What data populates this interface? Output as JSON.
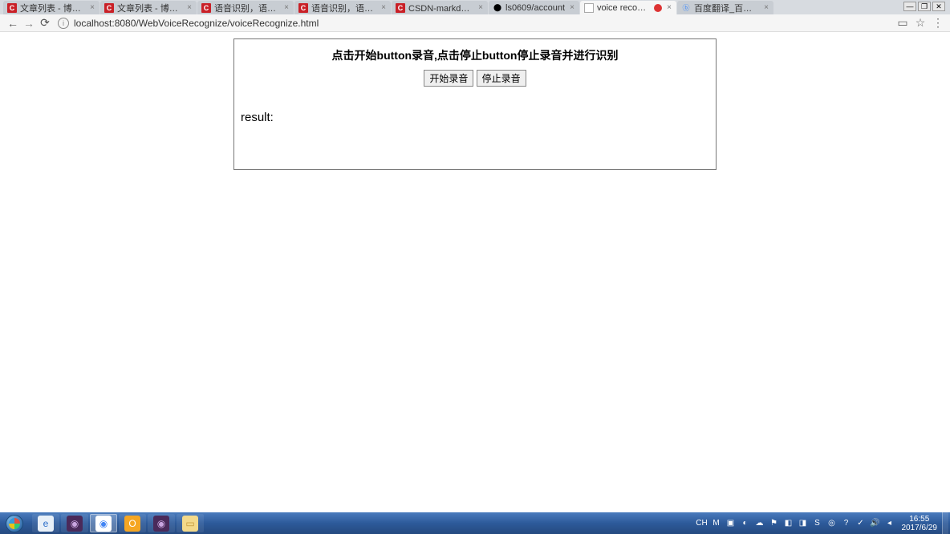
{
  "window_controls": {
    "minimize": "—",
    "restore": "❐",
    "close": "✕"
  },
  "tabs": [
    {
      "title": "文章列表 - 博客频道 - C",
      "favicon": "csdn",
      "faviconText": "C",
      "active": false
    },
    {
      "title": "文章列表 - 博客频道 - C",
      "favicon": "csdn",
      "faviconText": "C",
      "active": false
    },
    {
      "title": "语音识别，语义理解一站",
      "favicon": "csdn",
      "faviconText": "C",
      "active": false
    },
    {
      "title": "语音识别，语义理解一站",
      "favicon": "csdn",
      "faviconText": "C",
      "active": false
    },
    {
      "title": "CSDN-markdown编辑",
      "favicon": "csdn",
      "faviconText": "C",
      "active": false
    },
    {
      "title": "ls0609/account",
      "favicon": "github",
      "faviconText": "⬤",
      "active": false
    },
    {
      "title": "voice recognize test",
      "favicon": "blank",
      "faviconText": "",
      "active": true,
      "recording": true
    },
    {
      "title": "百度翻译_百度搜索",
      "favicon": "baidu",
      "faviconText": "ⓑ",
      "active": false
    }
  ],
  "url": "localhost:8080/WebVoiceRecognize/voiceRecognize.html",
  "page": {
    "heading": "点击开始button录音,点击停止button停止录音并进行识别",
    "startBtn": "开始录音",
    "stopBtn": "停止录音",
    "resultLabel": "result:"
  },
  "taskbar": {
    "items": [
      {
        "name": "ie",
        "bg": "#e8f0f8",
        "text": "e",
        "color": "#2a6dc9"
      },
      {
        "name": "eclipse1",
        "bg": "#4a2a5a",
        "text": "◉",
        "color": "#c9a6e0"
      },
      {
        "name": "chrome",
        "bg": "#fff",
        "text": "◉",
        "color": "#4285f4",
        "active": true
      },
      {
        "name": "outlook",
        "bg": "#f5a623",
        "text": "O",
        "color": "#fff"
      },
      {
        "name": "eclipse2",
        "bg": "#4a2a5a",
        "text": "◉",
        "color": "#c9a6e0"
      },
      {
        "name": "explorer",
        "bg": "#f3d98a",
        "text": "▭",
        "color": "#c4983a"
      }
    ],
    "tray": {
      "lang": "CH",
      "items": [
        "M",
        "▣",
        "◐",
        "☁",
        "⚑",
        "◧",
        "◨",
        "S",
        "◎",
        "?",
        "✓",
        "🔊",
        "◂"
      ]
    },
    "clock": {
      "time": "16:55",
      "date": "2017/6/29"
    }
  }
}
